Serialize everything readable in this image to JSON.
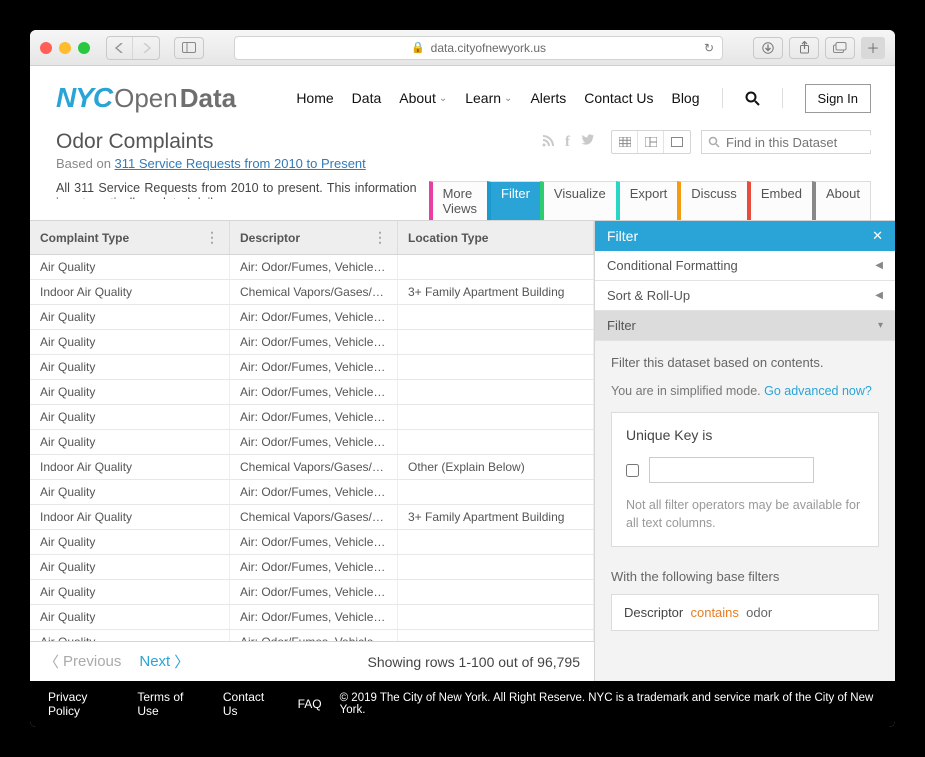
{
  "browser": {
    "url": "data.cityofnewyork.us"
  },
  "logo": {
    "nyc": "NYC",
    "open": "Open",
    "data": "Data"
  },
  "nav": {
    "home": "Home",
    "data": "Data",
    "about": "About",
    "learn": "Learn",
    "alerts": "Alerts",
    "contact": "Contact Us",
    "blog": "Blog",
    "signin": "Sign In"
  },
  "dataset": {
    "title": "Odor Complaints",
    "based_prefix": "Based on ",
    "based_link": "311 Service Requests from 2010 to Present",
    "description": "All 311 Service Requests from 2010 to present. This information is automatically updated daily."
  },
  "find_placeholder": "Find in this Dataset",
  "tabs": {
    "more": "More Views",
    "filter": "Filter",
    "visualize": "Visualize",
    "export": "Export",
    "discuss": "Discuss",
    "embed": "Embed",
    "about": "About"
  },
  "columns": {
    "c1": "Complaint Type",
    "c2": "Descriptor",
    "c3": "Location Type"
  },
  "rows": [
    {
      "c1": "Air Quality",
      "c2": "Air: Odor/Fumes, Vehicle Idling (AD...",
      "c3": ""
    },
    {
      "c1": "Indoor Air Quality",
      "c2": "Chemical Vapors/Gases/Odors",
      "c3": "3+ Family Apartment Building"
    },
    {
      "c1": "Air Quality",
      "c2": "Air: Odor/Fumes, Vehicle Idling (AD...",
      "c3": ""
    },
    {
      "c1": "Air Quality",
      "c2": "Air: Odor/Fumes, Vehicle Idling (AD...",
      "c3": ""
    },
    {
      "c1": "Air Quality",
      "c2": "Air: Odor/Fumes, Vehicle Idling (AD...",
      "c3": ""
    },
    {
      "c1": "Air Quality",
      "c2": "Air: Odor/Fumes, Vehicle Idling (AD...",
      "c3": ""
    },
    {
      "c1": "Air Quality",
      "c2": "Air: Odor/Fumes, Vehicle Idling (AD...",
      "c3": ""
    },
    {
      "c1": "Air Quality",
      "c2": "Air: Odor/Fumes, Vehicle Idling (AD...",
      "c3": ""
    },
    {
      "c1": "Indoor Air Quality",
      "c2": "Chemical Vapors/Gases/Odors",
      "c3": "Other (Explain Below)"
    },
    {
      "c1": "Air Quality",
      "c2": "Air: Odor/Fumes, Vehicle Idling (AD...",
      "c3": ""
    },
    {
      "c1": "Indoor Air Quality",
      "c2": "Chemical Vapors/Gases/Odors",
      "c3": "3+ Family Apartment Building"
    },
    {
      "c1": "Air Quality",
      "c2": "Air: Odor/Fumes, Vehicle Idling (AD...",
      "c3": ""
    },
    {
      "c1": "Air Quality",
      "c2": "Air: Odor/Fumes, Vehicle Idling (AD...",
      "c3": ""
    },
    {
      "c1": "Air Quality",
      "c2": "Air: Odor/Fumes, Vehicle Idling (AD...",
      "c3": ""
    },
    {
      "c1": "Air Quality",
      "c2": "Air: Odor/Fumes, Vehicle Idling (AD...",
      "c3": ""
    },
    {
      "c1": "Air Quality",
      "c2": "Air: Odor/Fumes, Vehicle Idling (AD...",
      "c3": ""
    }
  ],
  "pager": {
    "prev": "Previous",
    "next": "Next",
    "showing": "Showing rows 1-100 out of 96,795"
  },
  "panel": {
    "title": "Filter",
    "cond_fmt": "Conditional Formatting",
    "sort": "Sort & Roll-Up",
    "filter": "Filter",
    "hint": "Filter this dataset based on contents.",
    "mode_prefix": "You are in simplified mode. ",
    "mode_link": "Go advanced now?",
    "unique": "Unique Key  is",
    "note": "Not all filter operators may be available for all text columns.",
    "base_label": "With the following base filters",
    "base_field": "Descriptor",
    "base_op": "contains",
    "base_val": "odor"
  },
  "footer": {
    "privacy": "Privacy Policy",
    "terms": "Terms of Use",
    "contact": "Contact Us",
    "faq": "FAQ",
    "copyright": "© 2019 The City of New York. All Right Reserve. NYC is a trademark and service mark of the City of New York."
  }
}
